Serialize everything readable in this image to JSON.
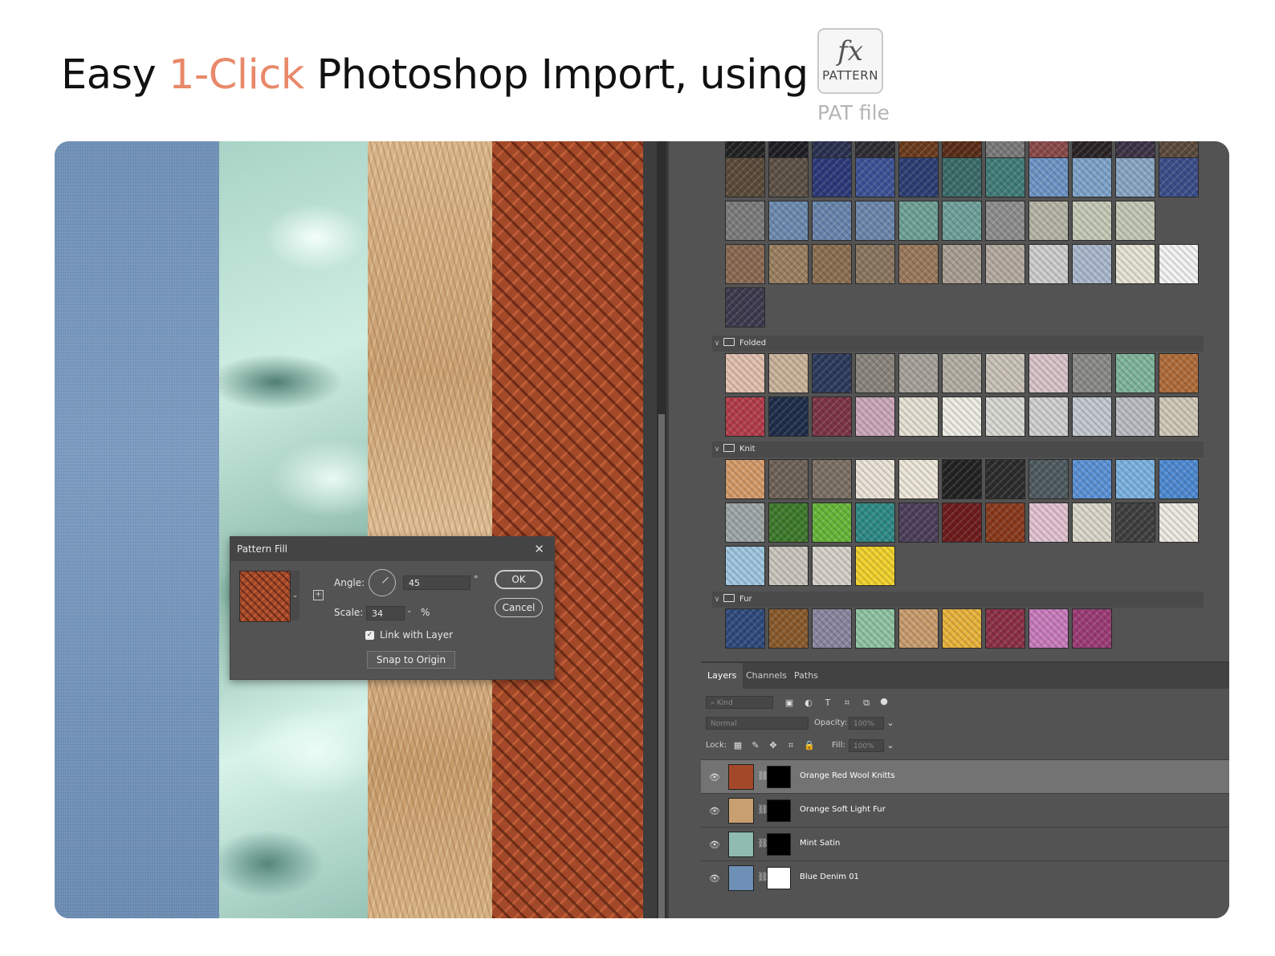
{
  "headline": {
    "pre": "Easy ",
    "accent": "1-Click",
    "post": " Photoshop Import, using"
  },
  "badge": {
    "fx": "fx",
    "label": "PATTERN",
    "caption": "PAT file"
  },
  "colors": {
    "accent": "#e8896a",
    "panel": "#535353",
    "dialog": "#535353"
  },
  "groups": {
    "folded": "Folded",
    "knit": "Knit",
    "fur": "Fur"
  },
  "dialog": {
    "title": "Pattern Fill",
    "close_icon": "close-icon",
    "angle_label": "Angle:",
    "angle_value": "45",
    "degree_sign": "°",
    "scale_label": "Scale:",
    "scale_value": "34",
    "percent_sign": "%",
    "link_label": "Link with Layer",
    "link_checked": true,
    "snap_label": "Snap to Origin",
    "ok_label": "OK",
    "cancel_label": "Cancel"
  },
  "layers_panel": {
    "tabs": [
      "Layers",
      "Channels",
      "Paths"
    ],
    "kind_placeholder": "Kind",
    "blend_mode": "Normal",
    "opacity_label": "Opacity:",
    "opacity_value": "100%",
    "lock_label": "Lock:",
    "fill_label": "Fill:",
    "fill_value": "100%",
    "layers": [
      {
        "name": "Orange Red Wool Knitts",
        "selected": true,
        "thumb": "#a4482a",
        "mask": "#000000"
      },
      {
        "name": "Orange Soft Light Fur",
        "selected": false,
        "thumb": "#c89f70",
        "mask": "#000000"
      },
      {
        "name": "Mint Satin",
        "selected": false,
        "thumb": "#8fbcae",
        "mask": "#000000"
      },
      {
        "name": "Blue Denim 01",
        "selected": false,
        "thumb": "#6f90b6",
        "mask": "#ffffff"
      }
    ]
  },
  "pattern_tiles": {
    "row0": [
      "#222",
      "#1d1d24",
      "#2a3150",
      "#2d2d33",
      "#6b3b1c",
      "#5a2d17",
      "#7a7a7a",
      "#8a4a4a",
      "#2b2326",
      "#3d3346",
      "#5a4a3c"
    ],
    "row1": [
      "#5a4a3a",
      "#5d5146",
      "#2c3a7a",
      "#3e5296",
      "#2c3f74",
      "#3b6c6a",
      "#417c79",
      "#6f95c5",
      "#7fa3c9",
      "#89a6c4",
      "#3b4e8a"
    ],
    "row2": [
      "#7c7c7c",
      "#6d8bb0",
      "#6985ad",
      "#6c87ad",
      "#6fa296",
      "#6fa19b",
      "#8e8e8e",
      "#b4b4a6",
      "#c4c9b6",
      "#c2c8b4"
    ],
    "row3": [
      "#8a6a52",
      "#9a8060",
      "#8c6f52",
      "#8a7660",
      "#9a7a5c",
      "#a99e92",
      "#b4aaa0",
      "#cdcdcd",
      "#aab8cc",
      "#e5e3d3",
      "#f2f2f2"
    ],
    "row4": [
      "#3e3a4e"
    ],
    "folded1": [
      "#e0bfae",
      "#c9b39a",
      "#2c3a5c",
      "#8a857c",
      "#a6a29a",
      "#b3aea3",
      "#c8c2b8",
      "#d8c3c8",
      "#8a8a86",
      "#7fb59c",
      "#b06c3a"
    ],
    "folded2": [
      "#b33d4a",
      "#1f2e4a",
      "#7d3548",
      "#caa7b9",
      "#e4e0d3",
      "#ecece4",
      "#d7d7d2",
      "#cfcfcf",
      "#c2c8cf",
      "#b9bcc2",
      "#cfc7b7"
    ],
    "knit1": [
      "#d49a6a",
      "#6e6258",
      "#7d7064",
      "#e9e2d6",
      "#ece6d8",
      "#222222",
      "#2c2c2c",
      "#4f5a60",
      "#5b92d6",
      "#7cb2e0",
      "#4f8ad1"
    ],
    "knit2": [
      "#9ea6a6",
      "#3e7a2c",
      "#67b63a",
      "#2f8a86",
      "#4c3f5c",
      "#6e1c1c",
      "#8a3a1c",
      "#e0c2cf",
      "#d9d6c9",
      "#3f3f3f",
      "#ece9e0"
    ],
    "knit3": [
      "#9ec6df",
      "#c9c5bc",
      "#d4d0c8",
      "#f0d12c"
    ],
    "fur1": [
      "#2f4a7d",
      "#8a5a2c",
      "#8b86a0",
      "#8fc3a2",
      "#c89c6e",
      "#e8b33c",
      "#8c3046",
      "#c87bbb",
      "#9c3c76"
    ]
  }
}
